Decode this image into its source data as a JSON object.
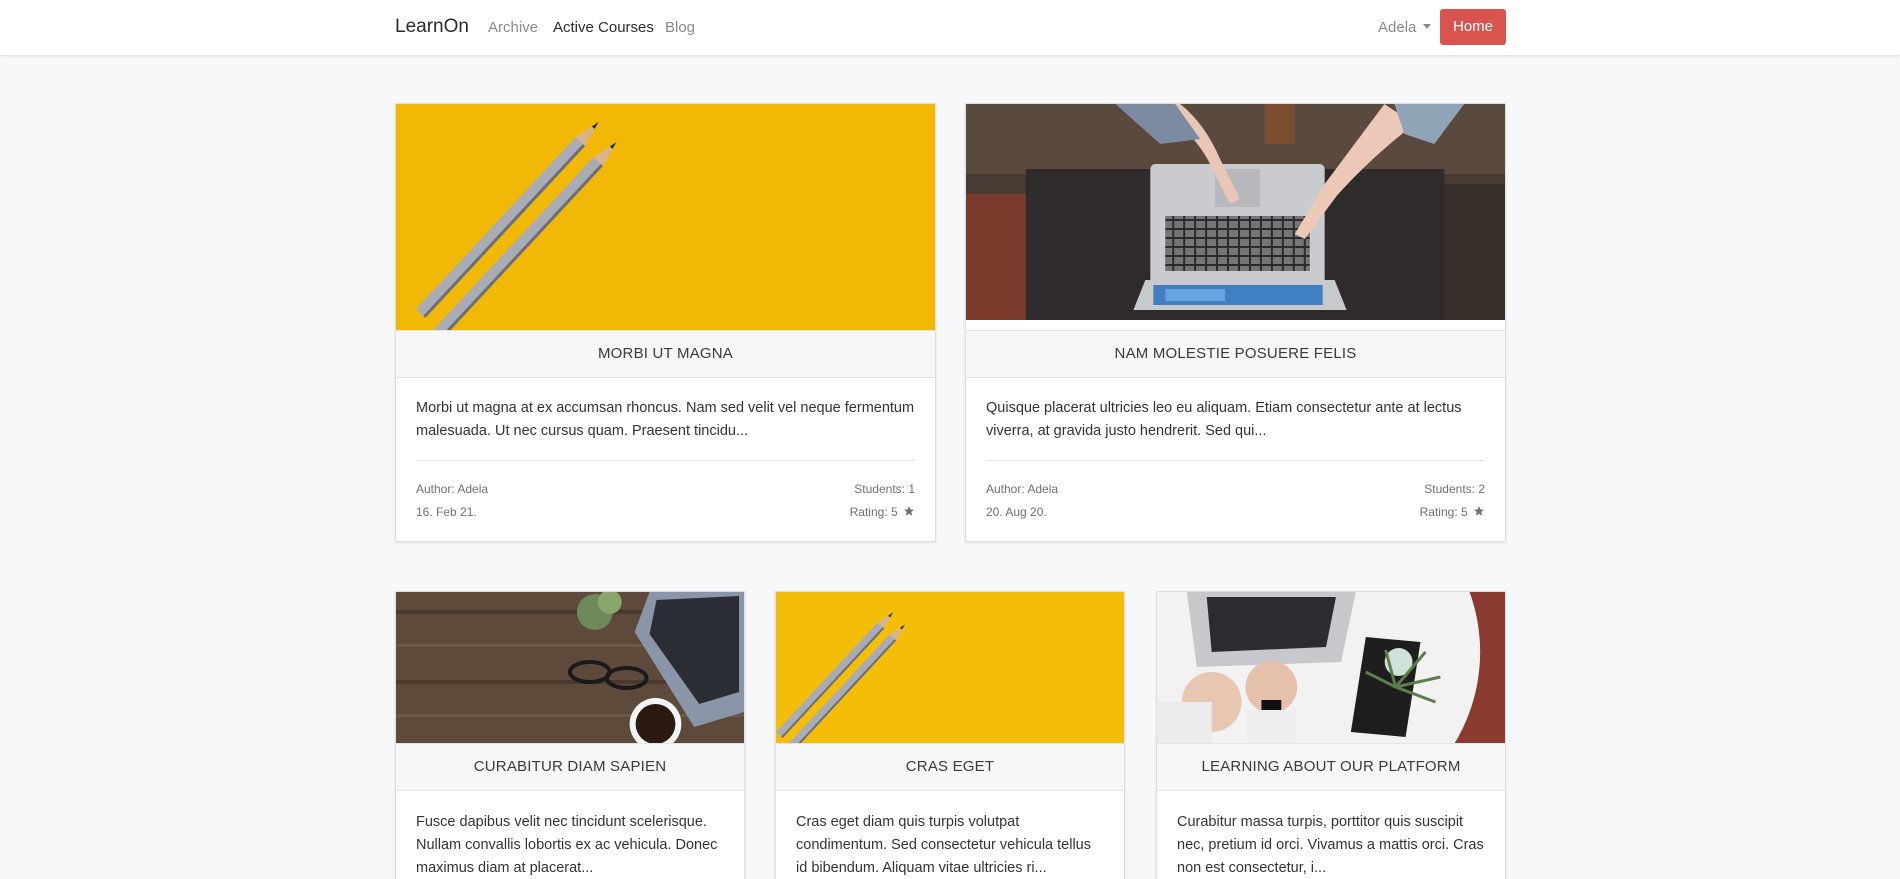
{
  "navbar": {
    "brand": "LearnOn",
    "links": [
      "Archive",
      "Active Courses",
      "Blog"
    ],
    "user": "Adela",
    "home_button": "Home"
  },
  "courses": [
    {
      "title": "MORBI UT MAGNA",
      "excerpt": "Morbi ut magna at ex accumsan rhoncus. Nam sed velit vel neque fermentum malesuada. Ut nec cursus quam. Praesent tincidu...",
      "author": "Author: Adela",
      "date": "16. Feb 21.",
      "students": "Students: 1",
      "rating": "Rating: 5",
      "image": "pencils-on-yellow"
    },
    {
      "title": "NAM MOLESTIE POSUERE FELIS",
      "excerpt": "Quisque placerat ultricies leo eu aliquam. Etiam consectetur ante at lectus viverra, at gravida justo hendrerit. Sed qui...",
      "author": "Author: Adela",
      "date": "20. Aug 20.",
      "students": "Students: 2",
      "rating": "Rating: 5",
      "image": "hands-on-laptop"
    },
    {
      "title": "CURABITUR DIAM SAPIEN",
      "excerpt": "Fusce dapibus velit nec tincidunt scelerisque. Nullam convallis lobortis ex ac vehicula. Donec maximus diam at placerat...",
      "image": "wooden-desk"
    },
    {
      "title": "CRAS EGET",
      "excerpt": "Cras eget diam quis turpis volutpat condimentum. Sed consectetur vehicula tellus id bibendum. Aliquam vitae ultricies ri...",
      "image": "pencils-on-yellow"
    },
    {
      "title": "LEARNING ABOUT OUR PLATFORM",
      "excerpt": "Curabitur massa turpis, porttitor quis suscipit nec, pretium id orci. Vivamus a mattis orci. Cras non est consectetur, i...",
      "image": "typing-white-desk"
    }
  ],
  "icons": {
    "rating": "star-icon",
    "user_menu": "chevron-down-icon"
  },
  "colors": {
    "home_button": "#d9534f",
    "page_background": "#f6f8fa",
    "image_yellow": "#f3bd08"
  }
}
